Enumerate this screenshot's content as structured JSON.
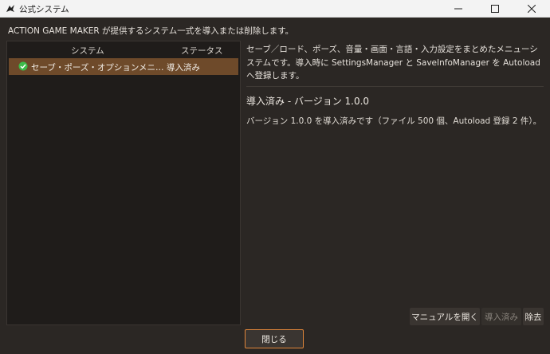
{
  "window": {
    "title": "公式システム",
    "icons": {
      "app": "app-logo-icon",
      "minimize": "minimize-icon",
      "maximize": "maximize-icon",
      "close": "close-icon"
    }
  },
  "intro_text": "ACTION GAME MAKER が提供するシステム一式を導入または削除します。",
  "list": {
    "headers": {
      "system": "システム",
      "status": "ステータス"
    },
    "rows": [
      {
        "name": "セーブ・ポーズ・オプションメニ…",
        "status": "導入済み",
        "icon": "check-circle-icon",
        "selected": true
      }
    ]
  },
  "detail": {
    "description": "セーブ／ロード、ポーズ、音量・画面・言語・入力設定をまとめたメニューシステムです。導入時に SettingsManager と SaveInfoManager を Autoload へ登録します。",
    "version_title": "導入済み - バージョン 1.0.0",
    "version_detail": "バージョン 1.0.0 を導入済みです（ファイル 500 個、Autoload 登録 2 件）。"
  },
  "buttons": {
    "manual": "マニュアルを開く",
    "installed": "導入済み",
    "remove": "除去",
    "close": "閉じる"
  },
  "colors": {
    "background": "#2b2724",
    "selected_row": "#6e4a2a",
    "check_green": "#3dbb4a",
    "close_border": "#e0863a"
  }
}
